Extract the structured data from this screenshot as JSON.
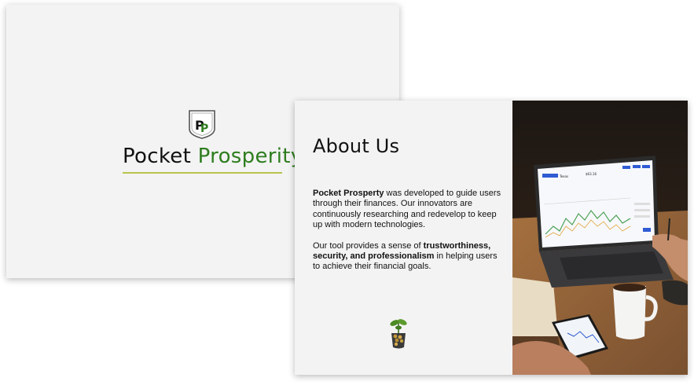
{
  "slide1": {
    "logo_letters": "PP",
    "brand_word1": "Pocket",
    "brand_word2": "Prosperity",
    "colors": {
      "brand_green": "#2e7d1e",
      "underline": "#b8c34a"
    }
  },
  "slide2": {
    "title": "About Us",
    "p1_bold": "Pocket Prosperty",
    "p1_rest": " was developed to guide users through their finances. Our innovators are continuously researching and redevelop to keep up with modern technologies.",
    "p2_start": "Our tool provides a sense of ",
    "p2_bold": "trustworthiness, security, and professionalism",
    "p2_end": " in helping users to achieve their financial goals.",
    "plant_icon": "plant-icon",
    "photo": {
      "laptop_app_title": "Texas",
      "laptop_price": "$63.16"
    }
  }
}
